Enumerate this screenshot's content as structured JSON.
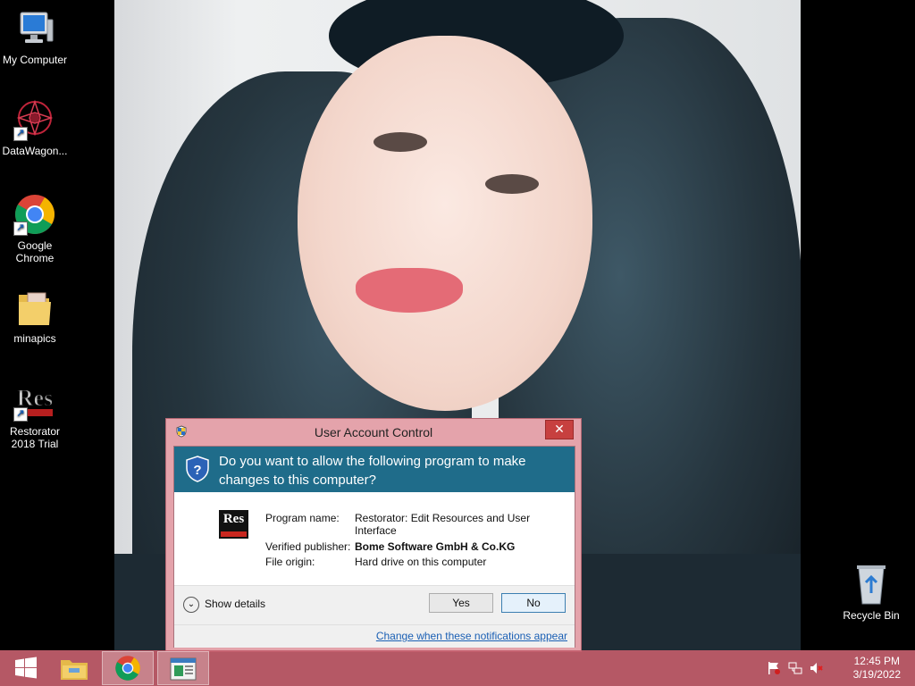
{
  "desktop": {
    "icons": [
      {
        "label": "My Computer",
        "icon": "computer-icon"
      },
      {
        "label": "DataWagon...",
        "icon": "datawagon-icon"
      },
      {
        "label": "Google Chrome",
        "icon": "chrome-icon"
      },
      {
        "label": "minapics",
        "icon": "folder-icon"
      },
      {
        "label": "Restorator 2018 Trial",
        "icon": "restorator-icon"
      },
      {
        "label": "Recycle Bin",
        "icon": "recycle-bin-icon"
      }
    ]
  },
  "dialog": {
    "title": "User Account Control",
    "close_label": "✕",
    "question": "Do you want to allow the following program to make changes to this computer?",
    "app_logo_text": "Res",
    "fields": {
      "program_name_key": "Program name:",
      "program_name_value": "Restorator: Edit Resources and User Interface",
      "publisher_key": "Verified publisher:",
      "publisher_value": "Bome Software GmbH & Co.KG",
      "origin_key": "File origin:",
      "origin_value": "Hard drive on this computer"
    },
    "show_details_label": "Show details",
    "yes_label": "Yes",
    "no_label": "No",
    "change_link": "Change when these notifications appear",
    "accent_color": "#1f6c8a"
  },
  "taskbar": {
    "color": "#c4606e",
    "items": [
      {
        "icon": "windows-start-icon"
      },
      {
        "icon": "file-explorer-icon"
      },
      {
        "icon": "chrome-icon"
      },
      {
        "icon": "uac-app-icon"
      }
    ],
    "tray": {
      "icons": [
        "action-center-flag-icon",
        "network-icon",
        "volume-muted-icon"
      ],
      "time": "12:45 PM",
      "date": "3/19/2022"
    }
  }
}
